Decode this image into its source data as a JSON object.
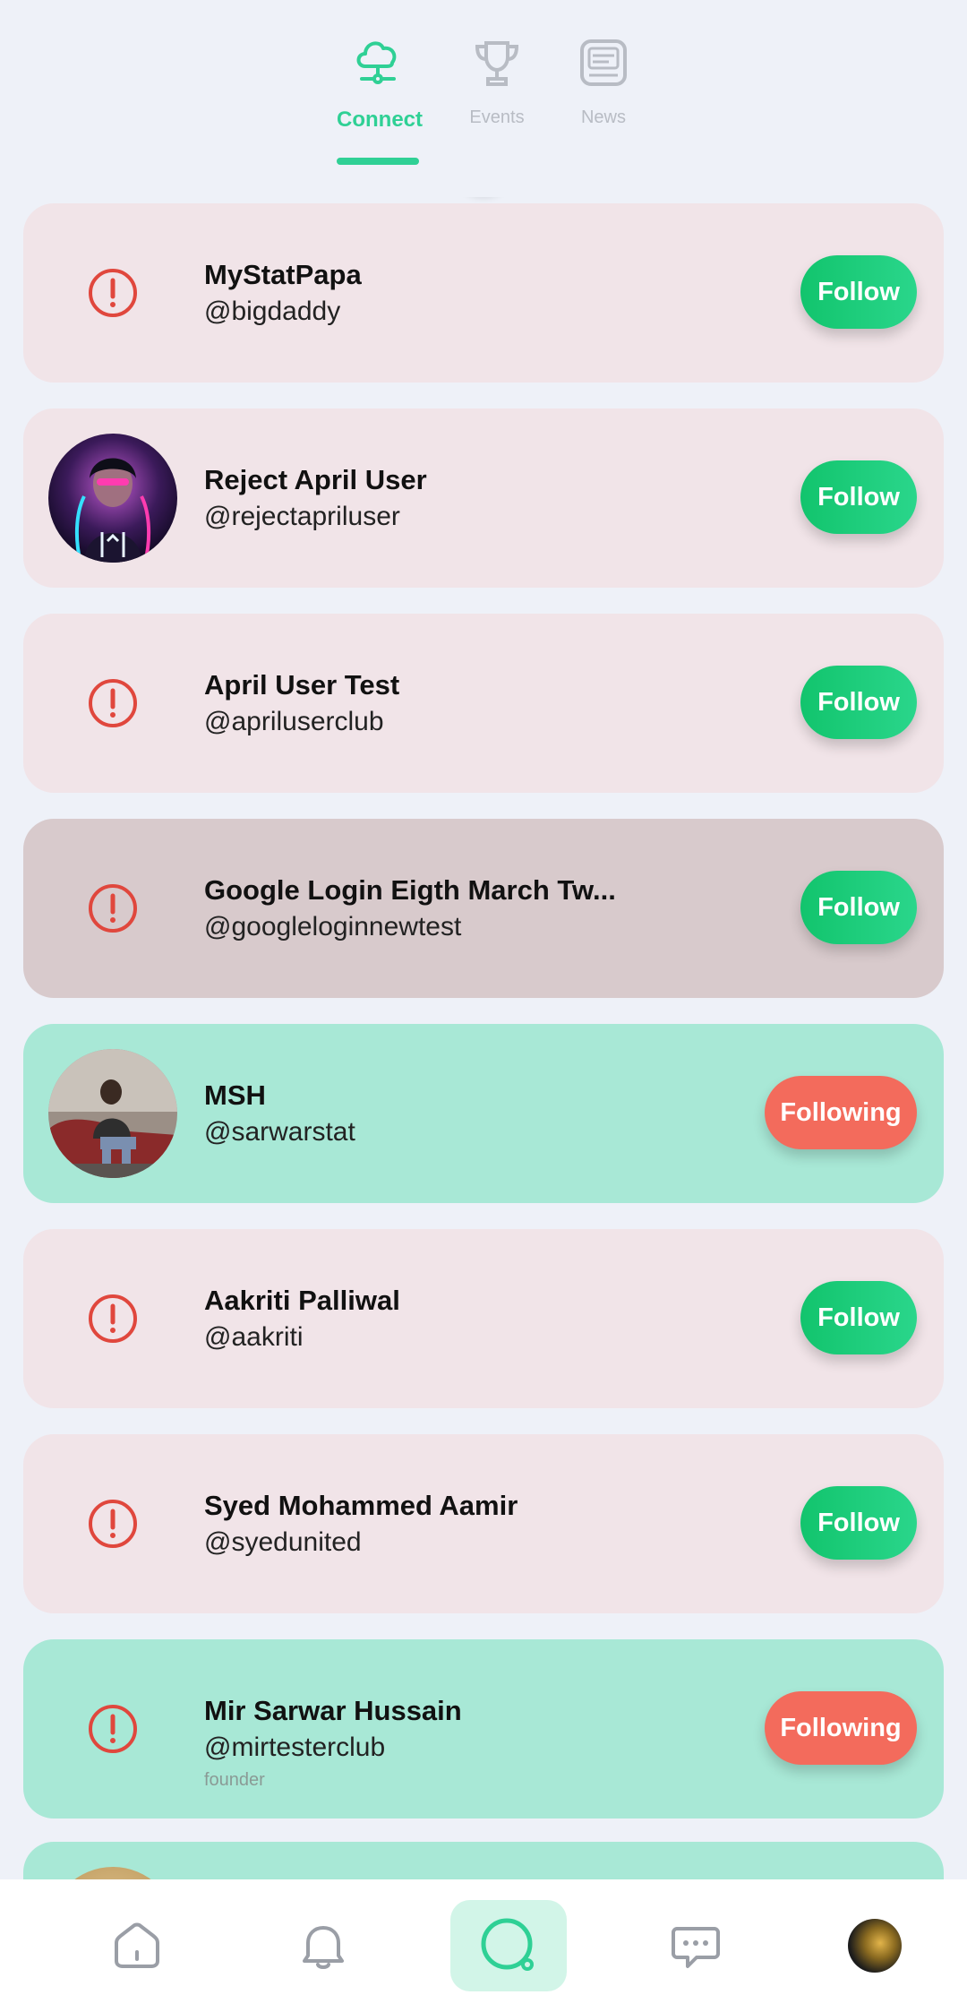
{
  "tabs": [
    {
      "label": "Connect",
      "icon": "cloud-network-icon",
      "active": true
    },
    {
      "label": "Events",
      "icon": "trophy-icon",
      "active": false
    },
    {
      "label": "News",
      "icon": "news-icon",
      "active": false
    }
  ],
  "users": [
    {
      "name": "MyStatPapa",
      "handle": "@bigdaddy",
      "avatar": "error-icon",
      "button": "Follow",
      "status": "default"
    },
    {
      "name": "Reject April User",
      "handle": "@rejectapriluser",
      "avatar": "photo",
      "button": "Follow",
      "status": "default"
    },
    {
      "name": "April User Test",
      "handle": "@apriluserclub",
      "avatar": "error-icon",
      "button": "Follow",
      "status": "default"
    },
    {
      "name": "Google Login Eigth March Tw...",
      "handle": "@googleloginnewtest",
      "avatar": "error-icon",
      "button": "Follow",
      "status": "pressed"
    },
    {
      "name": "MSH",
      "handle": "@sarwarstat",
      "avatar": "photo",
      "button": "Following",
      "status": "following"
    },
    {
      "name": "Aakriti Palliwal",
      "handle": "@aakriti",
      "avatar": "error-icon",
      "button": "Follow",
      "status": "default"
    },
    {
      "name": "Syed Mohammed Aamir",
      "handle": "@syedunited",
      "avatar": "error-icon",
      "button": "Follow",
      "status": "default"
    },
    {
      "name": "Mir Sarwar Hussain",
      "handle": "@mirtesterclub",
      "bio": "founder",
      "avatar": "error-icon",
      "button": "Following",
      "status": "following"
    }
  ],
  "colors": {
    "accent": "#2fd095",
    "follow_button": "#12c46d",
    "following_button": "#f36b5c",
    "card_default": "#f1e4e8",
    "card_following": "#a8e8d6",
    "error": "#e0473d"
  },
  "bottom_nav": [
    {
      "name": "home",
      "icon": "home-icon"
    },
    {
      "name": "notifications",
      "icon": "bell-icon"
    },
    {
      "name": "explore",
      "icon": "search-circle-icon",
      "active": true
    },
    {
      "name": "messages",
      "icon": "chat-icon"
    },
    {
      "name": "profile",
      "icon": "avatar"
    }
  ]
}
